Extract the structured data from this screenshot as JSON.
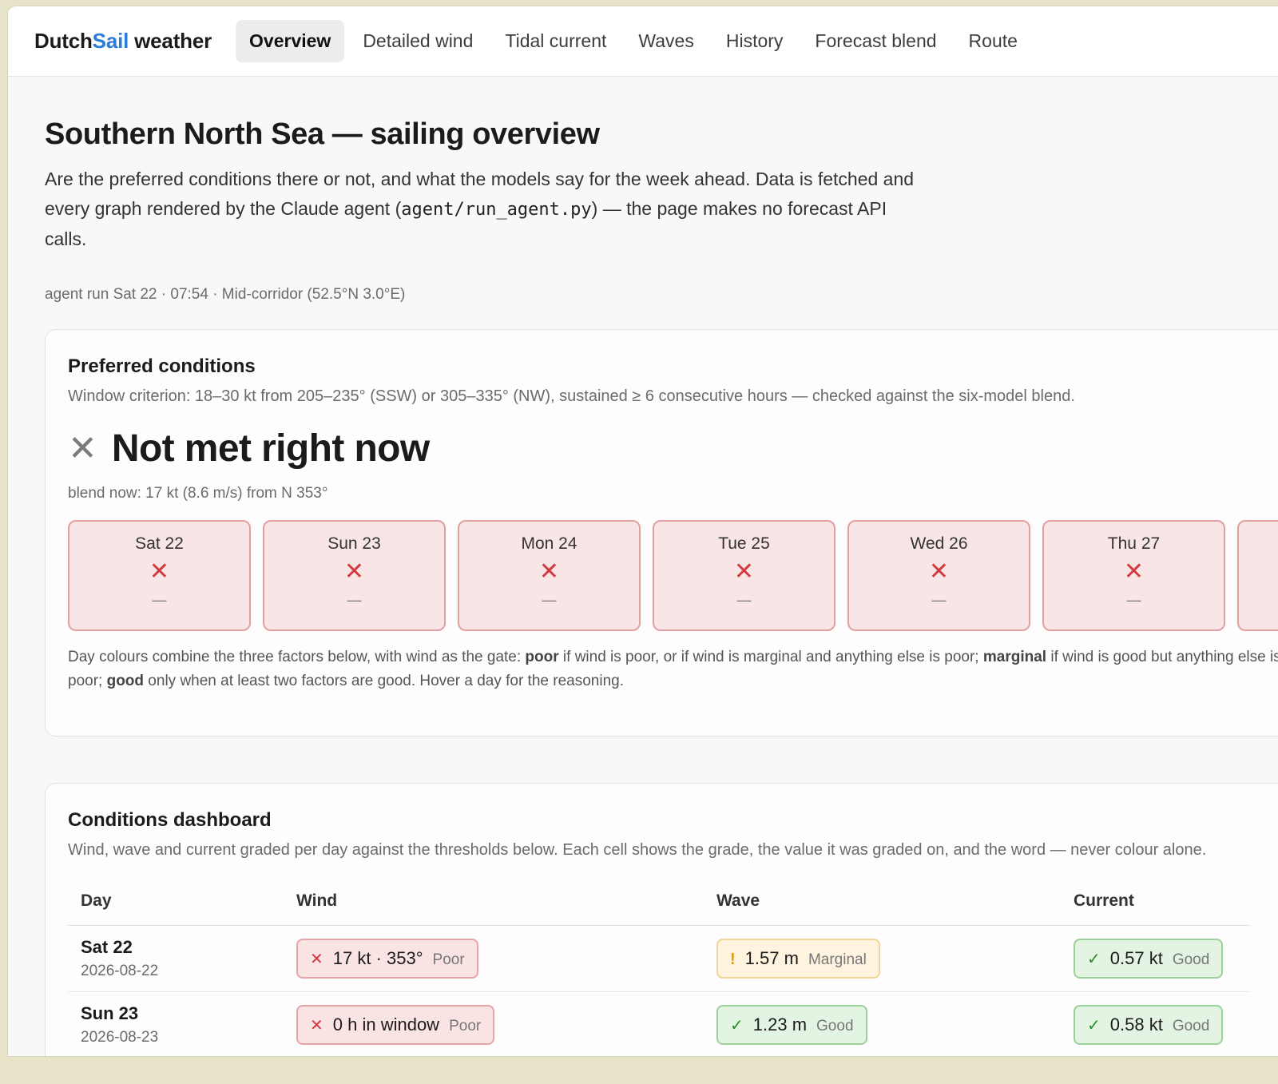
{
  "header": {
    "brand_prefix": "Dutch",
    "brand_accent": "Sail",
    "brand_suffix": " weather",
    "nav": [
      {
        "label": "Overview",
        "active": true
      },
      {
        "label": "Detailed wind"
      },
      {
        "label": "Tidal current"
      },
      {
        "label": "Waves"
      },
      {
        "label": "History"
      },
      {
        "label": "Forecast blend"
      },
      {
        "label": "Route"
      }
    ]
  },
  "page": {
    "title": "Southern North Sea — sailing overview",
    "intro_before": "Are the preferred conditions there or not, and what the models say for the week ahead. Data is fetched and every graph rendered by the Claude agent (",
    "intro_code": "agent/run_agent.py",
    "intro_after": ") — the page makes no forecast API calls.",
    "run_meta": "agent run Sat 22 · 07:54 · Mid-corridor (52.5°N 3.0°E)"
  },
  "preferred": {
    "title": "Preferred conditions",
    "criterion": "Window criterion: 18–30 kt from 205–235° (SSW) or 305–335° (NW), sustained ≥ 6 consecutive hours — checked against the six-model blend.",
    "status_icon": "✕",
    "status": "Not met right now",
    "blend_now": "blend now: 17 kt (8.6 m/s) from N 353°",
    "days": [
      {
        "name": "Sat 22",
        "mark": "✕",
        "detail": "—"
      },
      {
        "name": "Sun 23",
        "mark": "✕",
        "detail": "—"
      },
      {
        "name": "Mon 24",
        "mark": "✕",
        "detail": "—"
      },
      {
        "name": "Tue 25",
        "mark": "✕",
        "detail": "—"
      },
      {
        "name": "Wed 26",
        "mark": "✕",
        "detail": "—"
      },
      {
        "name": "Thu 27",
        "mark": "✕",
        "detail": "—"
      },
      {
        "name": "",
        "mark": "",
        "detail": ""
      }
    ],
    "legend": {
      "t1": "Day colours combine the three factors below, with wind as the gate: ",
      "b1": "poor",
      "t2": " if wind is poor, or if wind is marginal and anything else is poor; ",
      "b2": "marginal",
      "t3": " if wind is good but anything else is poor; ",
      "b3": "good",
      "t4": " only when at least two factors are good. Hover a day for the reasoning."
    }
  },
  "dashboard": {
    "title": "Conditions dashboard",
    "subtitle": "Wind, wave and current graded per day against the thresholds below. Each cell shows the grade, the value it was graded on, and the word — never colour alone.",
    "columns": [
      "Day",
      "Wind",
      "Wave",
      "Current"
    ],
    "rows": [
      {
        "day": "Sat 22",
        "date": "2026-08-22",
        "wind": {
          "icon": "✕",
          "value": "17 kt · 353°",
          "word": "Poor",
          "grade": "poor"
        },
        "wave": {
          "icon": "!",
          "value": "1.57 m",
          "word": "Marginal",
          "grade": "marginal"
        },
        "current": {
          "icon": "✓",
          "value": "0.57 kt",
          "word": "Good",
          "grade": "good"
        }
      },
      {
        "day": "Sun 23",
        "date": "2026-08-23",
        "wind": {
          "icon": "✕",
          "value": "0 h in window",
          "word": "Poor",
          "grade": "poor"
        },
        "wave": {
          "icon": "✓",
          "value": "1.23 m",
          "word": "Good",
          "grade": "good"
        },
        "current": {
          "icon": "✓",
          "value": "0.58 kt",
          "word": "Good",
          "grade": "good"
        }
      }
    ]
  },
  "colors": {
    "accent": "#2b7bd8",
    "poor": "#d33a3f",
    "marginal": "#e09a12",
    "good": "#2b8a2b"
  }
}
